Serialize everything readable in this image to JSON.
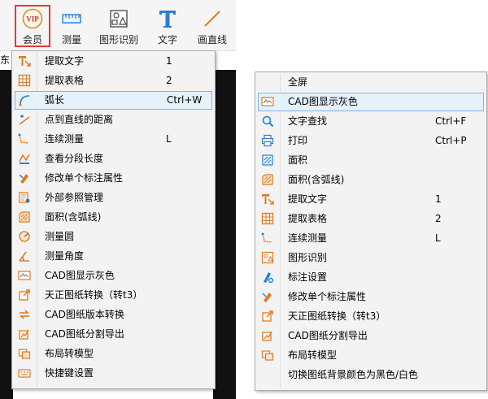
{
  "toolbar": {
    "vip": "会员",
    "vip_badge": "VIP",
    "measure": "测量",
    "shape_recognition": "图形识别",
    "text": "文字",
    "draw_line": "画直线"
  },
  "fragment": "东",
  "left_menu": {
    "items": [
      {
        "label": "提取文字",
        "shortcut": "1"
      },
      {
        "label": "提取表格",
        "shortcut": "2"
      },
      {
        "label": "弧长",
        "shortcut": "Ctrl+W"
      },
      {
        "label": "点到直线的距离",
        "shortcut": ""
      },
      {
        "label": "连续测量",
        "shortcut": "L"
      },
      {
        "label": "查看分段长度",
        "shortcut": ""
      },
      {
        "label": "修改单个标注属性",
        "shortcut": ""
      },
      {
        "label": "外部参照管理",
        "shortcut": ""
      },
      {
        "label": "面积(含弧线)",
        "shortcut": ""
      },
      {
        "label": "测量圆",
        "shortcut": ""
      },
      {
        "label": "测量角度",
        "shortcut": ""
      },
      {
        "label": "CAD图显示灰色",
        "shortcut": ""
      },
      {
        "label": "天正图纸转换（转t3）",
        "shortcut": ""
      },
      {
        "label": "CAD图纸版本转换",
        "shortcut": ""
      },
      {
        "label": "CAD图纸分割导出",
        "shortcut": ""
      },
      {
        "label": "布局转模型",
        "shortcut": ""
      },
      {
        "label": "快捷键设置",
        "shortcut": ""
      }
    ]
  },
  "right_menu": {
    "items": [
      {
        "label": "全屏",
        "shortcut": ""
      },
      {
        "label": "CAD图显示灰色",
        "shortcut": ""
      },
      {
        "label": "文字查找",
        "shortcut": "Ctrl+F"
      },
      {
        "label": "打印",
        "shortcut": "Ctrl+P"
      },
      {
        "label": "面积",
        "shortcut": ""
      },
      {
        "label": "面积(含弧线)",
        "shortcut": ""
      },
      {
        "label": "提取文字",
        "shortcut": "1"
      },
      {
        "label": "提取表格",
        "shortcut": "2"
      },
      {
        "label": "连续测量",
        "shortcut": "L"
      },
      {
        "label": "图形识别",
        "shortcut": ""
      },
      {
        "label": "标注设置",
        "shortcut": ""
      },
      {
        "label": "修改单个标注属性",
        "shortcut": ""
      },
      {
        "label": "天正图纸转换（转t3）",
        "shortcut": ""
      },
      {
        "label": "CAD图纸分割导出",
        "shortcut": ""
      },
      {
        "label": "布局转模型",
        "shortcut": ""
      },
      {
        "label": "切换图纸背景颜色为黑色/白色",
        "shortcut": ""
      }
    ]
  },
  "colors": {
    "accent_red": "#e53935",
    "vip_gold": "#d4912a",
    "icon_blue": "#2a7fd0",
    "icon_orange": "#e07a1f",
    "highlight_bg": "#e5f1fb",
    "highlight_border": "#7eb4ea"
  }
}
